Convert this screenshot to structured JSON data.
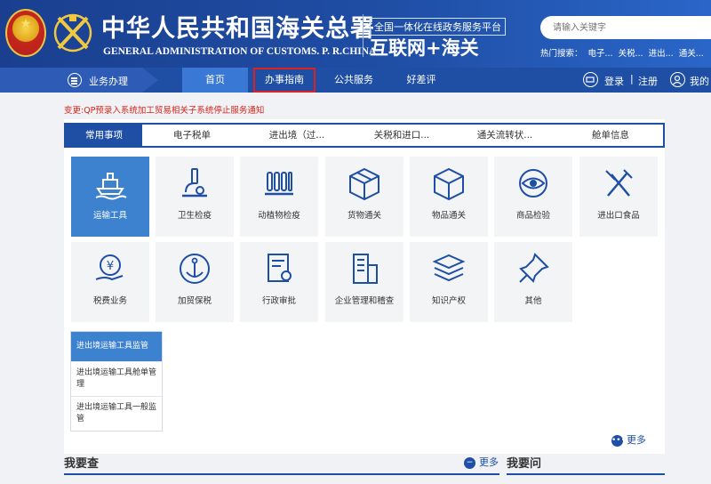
{
  "header": {
    "title_cn": "中华人民共和国海关总署",
    "title_en": "GENERAL ADMINISTRATION OF CUSTOMS. P. R.CHINA",
    "platform": "全国一体化在线政务服务平台",
    "brand": "互联网+海关",
    "search_placeholder": "请输入关键字",
    "hot_label": "热门搜索：",
    "hot_items": [
      "电子...",
      "关税...",
      "进出...",
      "通关..."
    ]
  },
  "nav": {
    "business": "业务办理",
    "items": [
      "首页",
      "办事指南",
      "公共服务",
      "好差评"
    ],
    "login": "登录",
    "separator": "|",
    "register": "注册",
    "mine": "我的"
  },
  "notice": "变更:QP预录入系统加工贸易相关子系统停止服务通知",
  "tabs": [
    "常用事项",
    "电子税单",
    "进出境（过...",
    "关税和进口...",
    "通关流转状...",
    "舱单信息"
  ],
  "tiles": [
    {
      "label": "运输工具",
      "icon": "ship-icon"
    },
    {
      "label": "卫生检疫",
      "icon": "microscope-icon"
    },
    {
      "label": "动植物检疫",
      "icon": "test-tubes-icon"
    },
    {
      "label": "货物通关",
      "icon": "box-icon"
    },
    {
      "label": "物品通关",
      "icon": "cube-icon"
    },
    {
      "label": "商品检验",
      "icon": "eye-icon"
    },
    {
      "label": "进出口食品",
      "icon": "utensils-icon"
    },
    {
      "label": "税费业务",
      "icon": "yen-hand-icon"
    },
    {
      "label": "加贸保税",
      "icon": "anchor-icon"
    },
    {
      "label": "行政审批",
      "icon": "document-stamp-icon"
    },
    {
      "label": "企业管理和稽查",
      "icon": "building-icon"
    },
    {
      "label": "知识产权",
      "icon": "stack-icon"
    },
    {
      "label": "其他",
      "icon": "pin-icon"
    }
  ],
  "submenu": [
    "进出境运输工具监管",
    "进出境运输工具舱单管理",
    "进出境运输工具一般监管"
  ],
  "more": "更多",
  "sections": {
    "left_title": "我要查",
    "left_more": "更多",
    "right_title": "我要问"
  },
  "colors": {
    "header_blue": "#1f4ea5",
    "selected_tile": "#3c82ce",
    "notice_red": "#d9241b",
    "highlight_border": "#e02020"
  }
}
